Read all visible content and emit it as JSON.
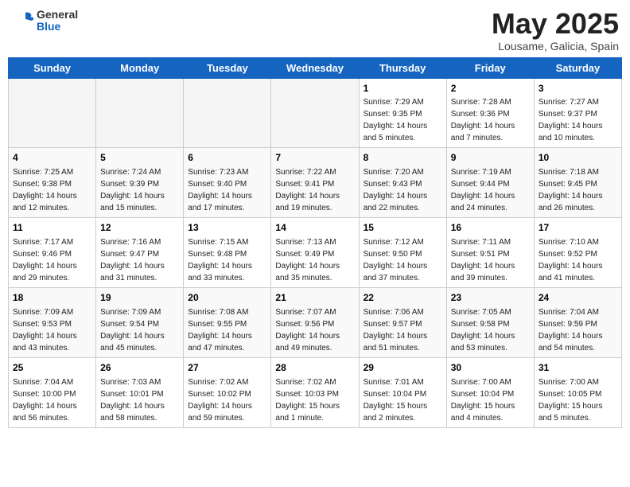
{
  "header": {
    "logo_general": "General",
    "logo_blue": "Blue",
    "month_title": "May 2025",
    "location": "Lousame, Galicia, Spain"
  },
  "weekdays": [
    "Sunday",
    "Monday",
    "Tuesday",
    "Wednesday",
    "Thursday",
    "Friday",
    "Saturday"
  ],
  "weeks": [
    [
      {
        "day": "",
        "info": ""
      },
      {
        "day": "",
        "info": ""
      },
      {
        "day": "",
        "info": ""
      },
      {
        "day": "",
        "info": ""
      },
      {
        "day": "1",
        "info": "Sunrise: 7:29 AM\nSunset: 9:35 PM\nDaylight: 14 hours\nand 5 minutes."
      },
      {
        "day": "2",
        "info": "Sunrise: 7:28 AM\nSunset: 9:36 PM\nDaylight: 14 hours\nand 7 minutes."
      },
      {
        "day": "3",
        "info": "Sunrise: 7:27 AM\nSunset: 9:37 PM\nDaylight: 14 hours\nand 10 minutes."
      }
    ],
    [
      {
        "day": "4",
        "info": "Sunrise: 7:25 AM\nSunset: 9:38 PM\nDaylight: 14 hours\nand 12 minutes."
      },
      {
        "day": "5",
        "info": "Sunrise: 7:24 AM\nSunset: 9:39 PM\nDaylight: 14 hours\nand 15 minutes."
      },
      {
        "day": "6",
        "info": "Sunrise: 7:23 AM\nSunset: 9:40 PM\nDaylight: 14 hours\nand 17 minutes."
      },
      {
        "day": "7",
        "info": "Sunrise: 7:22 AM\nSunset: 9:41 PM\nDaylight: 14 hours\nand 19 minutes."
      },
      {
        "day": "8",
        "info": "Sunrise: 7:20 AM\nSunset: 9:43 PM\nDaylight: 14 hours\nand 22 minutes."
      },
      {
        "day": "9",
        "info": "Sunrise: 7:19 AM\nSunset: 9:44 PM\nDaylight: 14 hours\nand 24 minutes."
      },
      {
        "day": "10",
        "info": "Sunrise: 7:18 AM\nSunset: 9:45 PM\nDaylight: 14 hours\nand 26 minutes."
      }
    ],
    [
      {
        "day": "11",
        "info": "Sunrise: 7:17 AM\nSunset: 9:46 PM\nDaylight: 14 hours\nand 29 minutes."
      },
      {
        "day": "12",
        "info": "Sunrise: 7:16 AM\nSunset: 9:47 PM\nDaylight: 14 hours\nand 31 minutes."
      },
      {
        "day": "13",
        "info": "Sunrise: 7:15 AM\nSunset: 9:48 PM\nDaylight: 14 hours\nand 33 minutes."
      },
      {
        "day": "14",
        "info": "Sunrise: 7:13 AM\nSunset: 9:49 PM\nDaylight: 14 hours\nand 35 minutes."
      },
      {
        "day": "15",
        "info": "Sunrise: 7:12 AM\nSunset: 9:50 PM\nDaylight: 14 hours\nand 37 minutes."
      },
      {
        "day": "16",
        "info": "Sunrise: 7:11 AM\nSunset: 9:51 PM\nDaylight: 14 hours\nand 39 minutes."
      },
      {
        "day": "17",
        "info": "Sunrise: 7:10 AM\nSunset: 9:52 PM\nDaylight: 14 hours\nand 41 minutes."
      }
    ],
    [
      {
        "day": "18",
        "info": "Sunrise: 7:09 AM\nSunset: 9:53 PM\nDaylight: 14 hours\nand 43 minutes."
      },
      {
        "day": "19",
        "info": "Sunrise: 7:09 AM\nSunset: 9:54 PM\nDaylight: 14 hours\nand 45 minutes."
      },
      {
        "day": "20",
        "info": "Sunrise: 7:08 AM\nSunset: 9:55 PM\nDaylight: 14 hours\nand 47 minutes."
      },
      {
        "day": "21",
        "info": "Sunrise: 7:07 AM\nSunset: 9:56 PM\nDaylight: 14 hours\nand 49 minutes."
      },
      {
        "day": "22",
        "info": "Sunrise: 7:06 AM\nSunset: 9:57 PM\nDaylight: 14 hours\nand 51 minutes."
      },
      {
        "day": "23",
        "info": "Sunrise: 7:05 AM\nSunset: 9:58 PM\nDaylight: 14 hours\nand 53 minutes."
      },
      {
        "day": "24",
        "info": "Sunrise: 7:04 AM\nSunset: 9:59 PM\nDaylight: 14 hours\nand 54 minutes."
      }
    ],
    [
      {
        "day": "25",
        "info": "Sunrise: 7:04 AM\nSunset: 10:00 PM\nDaylight: 14 hours\nand 56 minutes."
      },
      {
        "day": "26",
        "info": "Sunrise: 7:03 AM\nSunset: 10:01 PM\nDaylight: 14 hours\nand 58 minutes."
      },
      {
        "day": "27",
        "info": "Sunrise: 7:02 AM\nSunset: 10:02 PM\nDaylight: 14 hours\nand 59 minutes."
      },
      {
        "day": "28",
        "info": "Sunrise: 7:02 AM\nSunset: 10:03 PM\nDaylight: 15 hours\nand 1 minute."
      },
      {
        "day": "29",
        "info": "Sunrise: 7:01 AM\nSunset: 10:04 PM\nDaylight: 15 hours\nand 2 minutes."
      },
      {
        "day": "30",
        "info": "Sunrise: 7:00 AM\nSunset: 10:04 PM\nDaylight: 15 hours\nand 4 minutes."
      },
      {
        "day": "31",
        "info": "Sunrise: 7:00 AM\nSunset: 10:05 PM\nDaylight: 15 hours\nand 5 minutes."
      }
    ]
  ]
}
